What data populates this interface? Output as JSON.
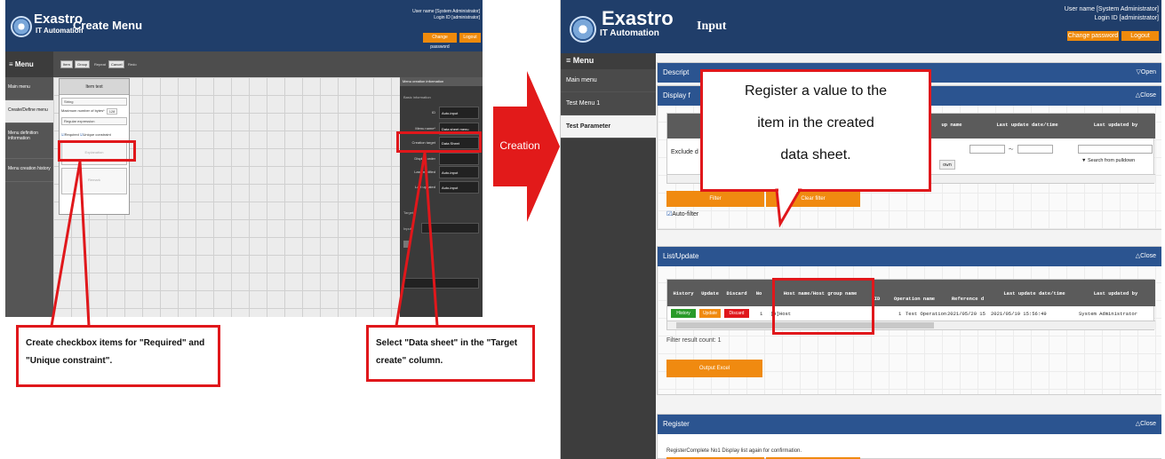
{
  "left": {
    "logo_name": "Exastro",
    "logo_sub": "IT Automation",
    "title": "Create Menu",
    "user_name": "User name [System Administrator]",
    "login_id": "Login ID [administrator]",
    "change_password": "Change password",
    "logout": "Logout",
    "menu_label": "≡ Menu",
    "toolbar": [
      "Item",
      "Group",
      "Repeat",
      "Cancel",
      "Redo"
    ],
    "sidebar": [
      "Main menu",
      "Create/Define menu",
      "Menu definition information",
      "Menu creation history"
    ],
    "card": {
      "header": "Item text",
      "type": "String",
      "max_bytes_label": "Maximum number of bytes*",
      "max_bytes_value": "128",
      "regex": "Regular expression",
      "required": "Required",
      "unique": "Unique constraint",
      "explanation": "Explanation",
      "remark": "Remark"
    },
    "panel": {
      "tab": "Menu creation information",
      "basic": "Basic information",
      "rows": [
        {
          "label": "ID",
          "value": "Auto-input"
        },
        {
          "label": "Menu name*",
          "value": "Data sheet menu"
        },
        {
          "label": "Creation target",
          "value": "Data Sheet"
        },
        {
          "label": "Display order",
          "value": ""
        },
        {
          "label": "Last modified",
          "value": "Auto-input"
        },
        {
          "label": "Last updated",
          "value": "Auto-input"
        }
      ],
      "target": "Target",
      "input": "Input*"
    },
    "ann_checkbox": "Create checkbox items for \"Required\" and \"Unique constraint\".",
    "ann_select": "Select \"Data sheet\" in the \"Target create\" column."
  },
  "arrow_label": "Creation",
  "right": {
    "logo_name": "Exastro",
    "logo_sub": "IT Automation",
    "title": "Input",
    "user_name": "User name [System Administrator]",
    "login_id": "Login ID [administrator]",
    "change_password": "Change password",
    "logout": "Logout",
    "menu_label": "≡ Menu",
    "sidebar": [
      "Main menu",
      "Test Menu 1",
      "Test Parameter"
    ],
    "description": {
      "title": "Descript",
      "toggle": "▽Open"
    },
    "display_filter": {
      "title": "Display f",
      "toggle": "△Close",
      "cols": [
        "up name",
        "Last update date/time",
        "Last updated by"
      ],
      "exclude": "Exclude d",
      "own": "own",
      "tilde": "～",
      "search_pulldown": "▼ Search from pulldown",
      "filter": "Filter",
      "clear_filter": "Clear filter",
      "auto_filter": "Auto-filter"
    },
    "list": {
      "title": "List/Update",
      "toggle": "△Close",
      "headers": [
        "History",
        "Update",
        "Discard",
        "No",
        "Host name/Host group name",
        "ID",
        "Operation name",
        "Reference d",
        "Last update date/time",
        "Last updated by"
      ],
      "row": {
        "history": "History",
        "update": "Update",
        "discard": "Discard",
        "no": "1",
        "host": "[H]Host",
        "id": "1",
        "operation": "Test Operation",
        "ref": "2021/05/20 15",
        "updated": "2021/05/19 15:56:49",
        "by": "System Administrator"
      },
      "count": "Filter result count: 1",
      "output_excel": "Output Excel"
    },
    "register": {
      "title": "Register",
      "toggle": "△Close",
      "message": "RegisterComplete No1 Display list again for confirmation."
    },
    "callout": [
      "Register a value to the",
      "item in the created",
      "data sheet."
    ]
  },
  "colors": {
    "accent_red": "#e0171b",
    "header_blue": "#203e6a",
    "orange": "#f08a10"
  }
}
